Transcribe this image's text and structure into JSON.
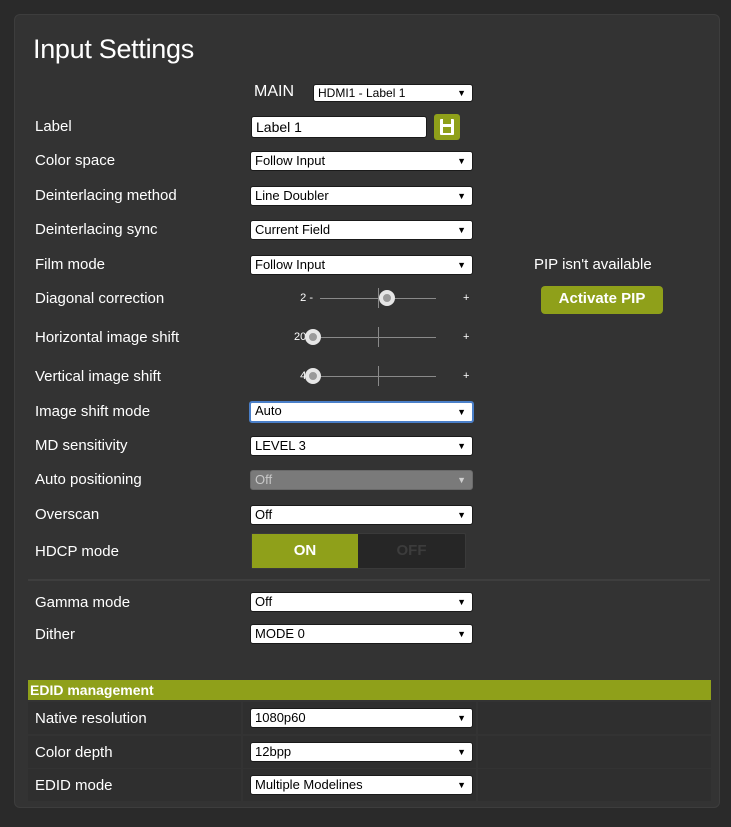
{
  "page": {
    "title": "Input Settings"
  },
  "main": {
    "label": "MAIN",
    "selected": "HDMI1 - Label 1"
  },
  "settings": {
    "label": {
      "label": "Label",
      "value": "Label 1"
    },
    "color_space": {
      "label": "Color space",
      "value": "Follow Input"
    },
    "deint_method": {
      "label": "Deinterlacing method",
      "value": "Line Doubler"
    },
    "deint_sync": {
      "label": "Deinterlacing sync",
      "value": "Current Field"
    },
    "film_mode": {
      "label": "Film mode",
      "value": "Follow Input"
    },
    "diagonal": {
      "label": "Diagonal correction",
      "min_text": "2 -",
      "plus": "+",
      "level": 0.5
    },
    "hshift": {
      "label": "Horizontal image shift",
      "min_text": "20 -",
      "plus": "+",
      "level": 0.0
    },
    "vshift": {
      "label": "Vertical image shift",
      "min_text": "4 -",
      "plus": "+",
      "level": 0.0
    },
    "shift_mode": {
      "label": "Image shift mode",
      "value": "Auto"
    },
    "md_sens": {
      "label": "MD sensitivity",
      "value": "LEVEL 3"
    },
    "auto_pos": {
      "label": "Auto positioning",
      "value": "Off"
    },
    "overscan": {
      "label": "Overscan",
      "value": "Off"
    },
    "hdcp": {
      "label": "HDCP mode",
      "on": "ON",
      "off": "OFF"
    },
    "gamma": {
      "label": "Gamma mode",
      "value": "Off"
    },
    "dither": {
      "label": "Dither",
      "value": "MODE 0"
    }
  },
  "pip": {
    "note": "PIP isn't available",
    "button": "Activate PIP"
  },
  "edid": {
    "header": "EDID management",
    "native_res": {
      "label": "Native resolution",
      "value": "1080p60"
    },
    "color_depth": {
      "label": "Color depth",
      "value": "12bpp"
    },
    "edid_mode": {
      "label": "EDID mode",
      "value": "Multiple Modelines"
    }
  },
  "icons": {
    "arrow": "▼"
  },
  "colors": {
    "accent": "#8fa01a",
    "panel": "#333333",
    "background": "#2a2a2a"
  }
}
